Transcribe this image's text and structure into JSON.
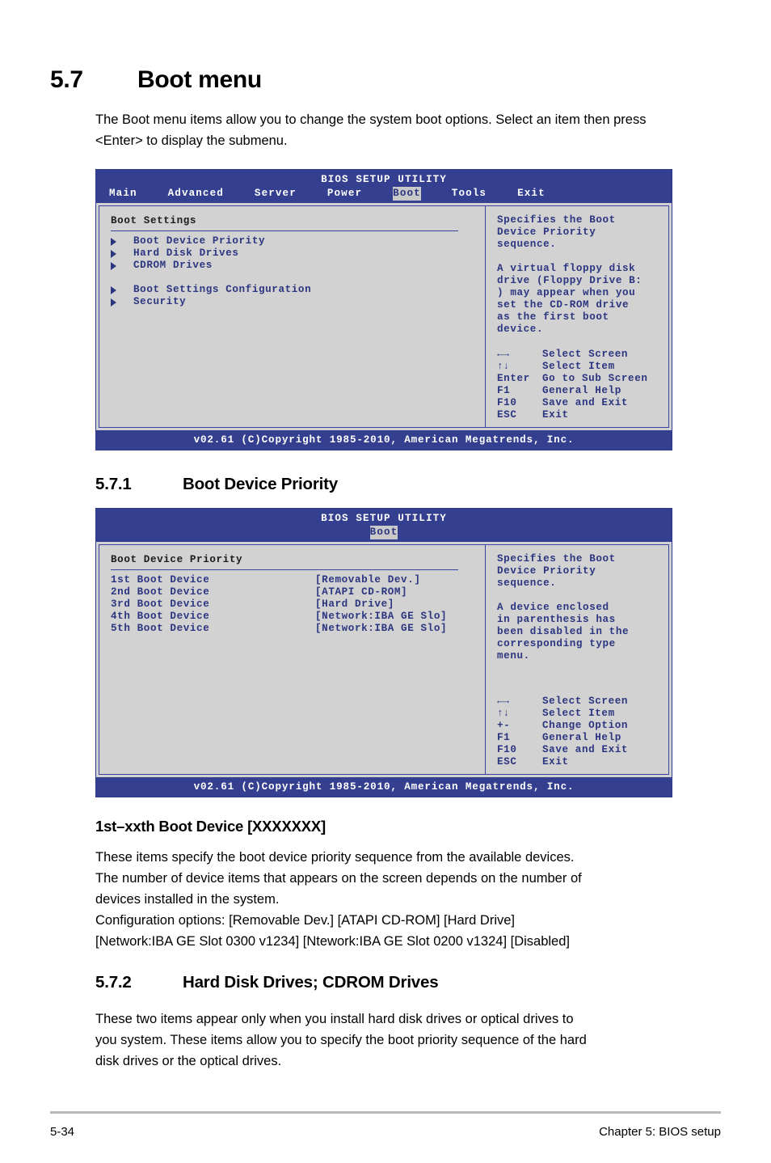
{
  "section": {
    "number": "5.7",
    "title": "Boot menu",
    "intro": "The Boot menu items allow you to change the system boot options. Select an item then press <Enter> to display the submenu."
  },
  "bios_screen_1": {
    "title": "BIOS SETUP UTILITY",
    "tabs": [
      {
        "label": "Main",
        "active": false
      },
      {
        "label": "Advanced",
        "active": false
      },
      {
        "label": "Server",
        "active": false
      },
      {
        "label": "Power",
        "active": false
      },
      {
        "label": "Boot",
        "active": true
      },
      {
        "label": "Tools",
        "active": false
      },
      {
        "label": "Exit",
        "active": false
      }
    ],
    "panel_title": "Boot Settings",
    "menu_items": [
      "Boot Device Priority",
      "Hard Disk Drives",
      "CDROM Drives",
      "Boot Settings Configuration",
      "Security"
    ],
    "help_lines": [
      "Specifies the Boot",
      "Device Priority",
      "sequence.",
      "",
      "A virtual floppy disk",
      "drive (Floppy Drive B:",
      ") may appear when you",
      "set the CD-ROM drive",
      "as the first boot",
      "device."
    ],
    "legend": [
      {
        "key": "←→",
        "desc": "Select Screen"
      },
      {
        "key": "↑↓",
        "desc": "Select Item"
      },
      {
        "key": "Enter",
        "desc": "Go to Sub Screen"
      },
      {
        "key": "F1",
        "desc": "General Help"
      },
      {
        "key": "F10",
        "desc": "Save and Exit"
      },
      {
        "key": "ESC",
        "desc": "Exit"
      }
    ],
    "footer": "v02.61  (C)Copyright 1985-2010, American Megatrends, Inc."
  },
  "subsection_1": {
    "number": "5.7.1",
    "title": "Boot Device Priority"
  },
  "bios_screen_2": {
    "title": "BIOS SETUP UTILITY",
    "tabs": [
      {
        "label": "Boot",
        "active": true
      }
    ],
    "panel_title": "Boot Device Priority",
    "rows": [
      {
        "label": "1st Boot Device",
        "value": "[Removable Dev.]"
      },
      {
        "label": "2nd Boot Device",
        "value": "[ATAPI CD-ROM]"
      },
      {
        "label": "3rd Boot Device",
        "value": "[Hard Drive]"
      },
      {
        "label": "4th Boot Device",
        "value": "[Network:IBA GE Slo]"
      },
      {
        "label": "5th Boot Device",
        "value": "[Network:IBA GE Slo]"
      }
    ],
    "help_lines": [
      "Specifies the Boot",
      "Device Priority",
      "sequence.",
      "",
      "A device enclosed",
      "in parenthesis has",
      "been disabled in the",
      "corresponding type",
      "menu."
    ],
    "legend": [
      {
        "key": "←→",
        "desc": "Select Screen"
      },
      {
        "key": "↑↓",
        "desc": "Select Item"
      },
      {
        "key": "+-",
        "desc": "Change Option"
      },
      {
        "key": "F1",
        "desc": "General Help"
      },
      {
        "key": "F10",
        "desc": "Save and Exit"
      },
      {
        "key": "ESC",
        "desc": "Exit"
      }
    ],
    "footer": "v02.61  (C)Copyright 1985-2010, American Megatrends, Inc."
  },
  "item_heading": "1st–xxth Boot Device [XXXXXXX]",
  "item_body": [
    "These items specify the boot device priority sequence from the available devices.",
    "The number of device items that appears on the screen depends on the number of",
    "devices installed in the system.",
    "Configuration options: [Removable Dev.] [ATAPI CD-ROM] [Hard Drive]",
    "[Network:IBA GE Slot 0300 v1234] [Ntework:IBA GE Slot 0200 v1324] [Disabled]"
  ],
  "subsection_2": {
    "number": "5.7.2",
    "title": "Hard Disk Drives; CDROM Drives",
    "body": [
      "These two items appear only when you install hard disk drives or optical drives to",
      "you system. These items allow you to specify the boot priority sequence of the hard",
      "disk drives or the optical drives."
    ]
  },
  "footer": {
    "page_number": "5-34",
    "chapter": "Chapter 5: BIOS setup"
  },
  "colors": {
    "bios_header_bg": "#343f8f",
    "bios_panel_bg": "#d2d2d2",
    "bios_text": "#2b3580",
    "bios_border": "#3a44a0",
    "tab_active_bg": "#c9c9c9"
  }
}
